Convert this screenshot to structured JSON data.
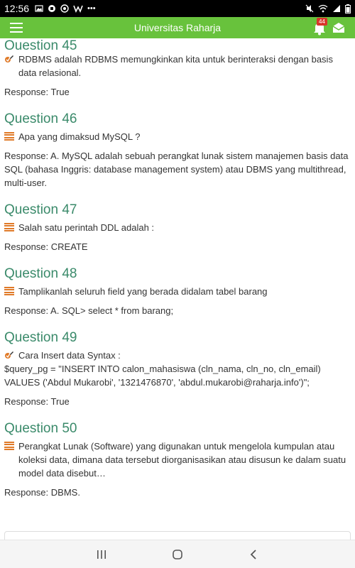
{
  "status_bar": {
    "time": "12:56",
    "left_icons": [
      "photo-icon",
      "chat-icon",
      "whatsapp-icon",
      "wattpad-icon",
      "more-icon"
    ],
    "right_icons": [
      "mute-icon",
      "wifi-icon",
      "signal-icon",
      "battery-icon"
    ]
  },
  "app_bar": {
    "title": "Universitas Raharja",
    "notification_count": "44",
    "accent": "#68c23c"
  },
  "response_label": "Response",
  "questions": [
    {
      "title": "Question 45",
      "icon": "check-edit-icon",
      "text": "RDBMS adalah RDBMS memungkinkan kita untuk berinteraksi dengan basis data relasional.",
      "response": ": True"
    },
    {
      "title": "Question 46",
      "icon": "list-icon",
      "text": "Apa yang dimaksud MySQL ?",
      "response": ": A. MySQL adalah sebuah perangkat lunak sistem manajemen basis data SQL (bahasa Inggris: database management system) atau DBMS yang multithread, multi-user."
    },
    {
      "title": "Question 47",
      "icon": "list-icon",
      "text": "Salah satu perintah DDL adalah :",
      "response": ": CREATE"
    },
    {
      "title": "Question 48",
      "icon": "list-icon",
      "text": "Tamplikanlah seluruh field yang berada didalam tabel barang",
      "response": ": A. SQL> select * from barang;"
    },
    {
      "title": "Question 49",
      "icon": "check-edit-icon",
      "text": "Cara Insert data Syntax :",
      "text_extra": "$query_pg = \"INSERT INTO calon_mahasiswa (cln_nama, cln_no, cln_email) VALUES ('Abdul Mukarobi', '1321476870', 'abdul.mukarobi@raharja.info')\";",
      "response": ": True"
    },
    {
      "title": "Question 50",
      "icon": "list-icon",
      "text": "Perangkat Lunak (Software) yang digunakan untuk mengelola kumpulan atau koleksi data, dimana data tersebut diorganisasikan atau disusun ke dalam suatu model data disebut…",
      "response": ": DBMS."
    }
  ],
  "colors": {
    "question_title": "#3a8a6a",
    "icon_orange": "#e07a28",
    "badge": "#d9352c"
  },
  "nav_bar": [
    "recent-apps-icon",
    "home-icon",
    "back-icon"
  ]
}
